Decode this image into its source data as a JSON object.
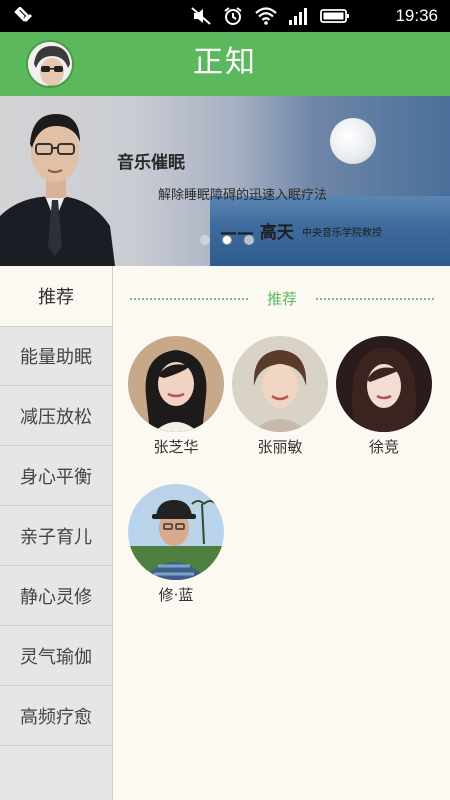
{
  "status_bar": {
    "time": "19:36",
    "icons": [
      "notification-icon",
      "mute-icon",
      "alarm-icon",
      "wifi-icon",
      "signal-icon",
      "battery-icon"
    ]
  },
  "header": {
    "title": "正知",
    "background": "#5cb85c"
  },
  "banner": {
    "headline": "音乐催眠",
    "subline": "解除睡眠障碍的迅速入眠疗法",
    "author": "—— 高天",
    "author_title": "中央音乐学院教授",
    "dots": 3,
    "active_dot": 2
  },
  "sidebar": {
    "items": [
      {
        "label": "推荐",
        "active": true
      },
      {
        "label": "能量助眠",
        "active": false
      },
      {
        "label": "减压放松",
        "active": false
      },
      {
        "label": "身心平衡",
        "active": false
      },
      {
        "label": "亲子育儿",
        "active": false
      },
      {
        "label": "静心灵修",
        "active": false
      },
      {
        "label": "灵气瑜伽",
        "active": false
      },
      {
        "label": "高频疗愈",
        "active": false
      }
    ]
  },
  "main": {
    "section_title": "推荐",
    "teachers": [
      {
        "name": "张芝华"
      },
      {
        "name": "张丽敏"
      },
      {
        "name": "徐竞"
      },
      {
        "name": "修·蓝"
      }
    ]
  }
}
